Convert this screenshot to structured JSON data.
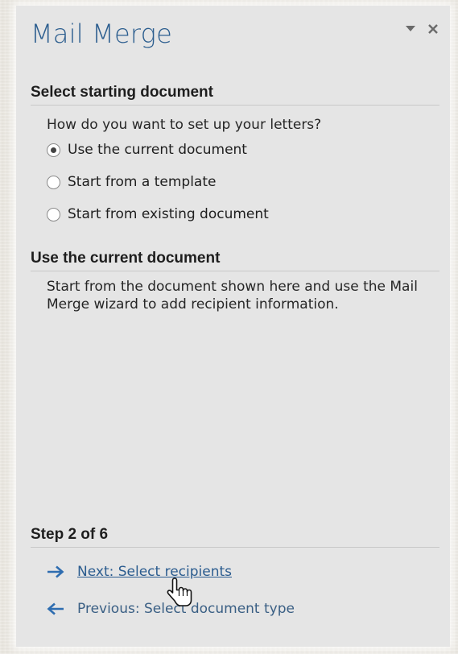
{
  "pane": {
    "title": "Mail Merge",
    "controls": {
      "menu_icon": "triangle-down-icon",
      "close_icon": "close-icon"
    }
  },
  "select_section": {
    "heading": "Select starting document",
    "question": "How do you want to set up your letters?",
    "options": [
      {
        "label": "Use the current document",
        "checked": true
      },
      {
        "label": "Start from a template",
        "checked": false
      },
      {
        "label": "Start from existing document",
        "checked": false
      }
    ]
  },
  "current_section": {
    "heading": "Use the current document",
    "description": "Start from the document shown here and use the Mail Merge wizard to add recipient information."
  },
  "step": {
    "label": "Step 2 of 6",
    "next": {
      "label": "Next: Select recipients",
      "icon": "arrow-right-icon"
    },
    "previous": {
      "label": "Previous: Select document type",
      "icon": "arrow-left-icon"
    }
  },
  "colors": {
    "title": "#2c5e8f",
    "link": "#2b5c8f",
    "arrow": "#2e6db0",
    "pane_bg": "#e5e5e5"
  }
}
